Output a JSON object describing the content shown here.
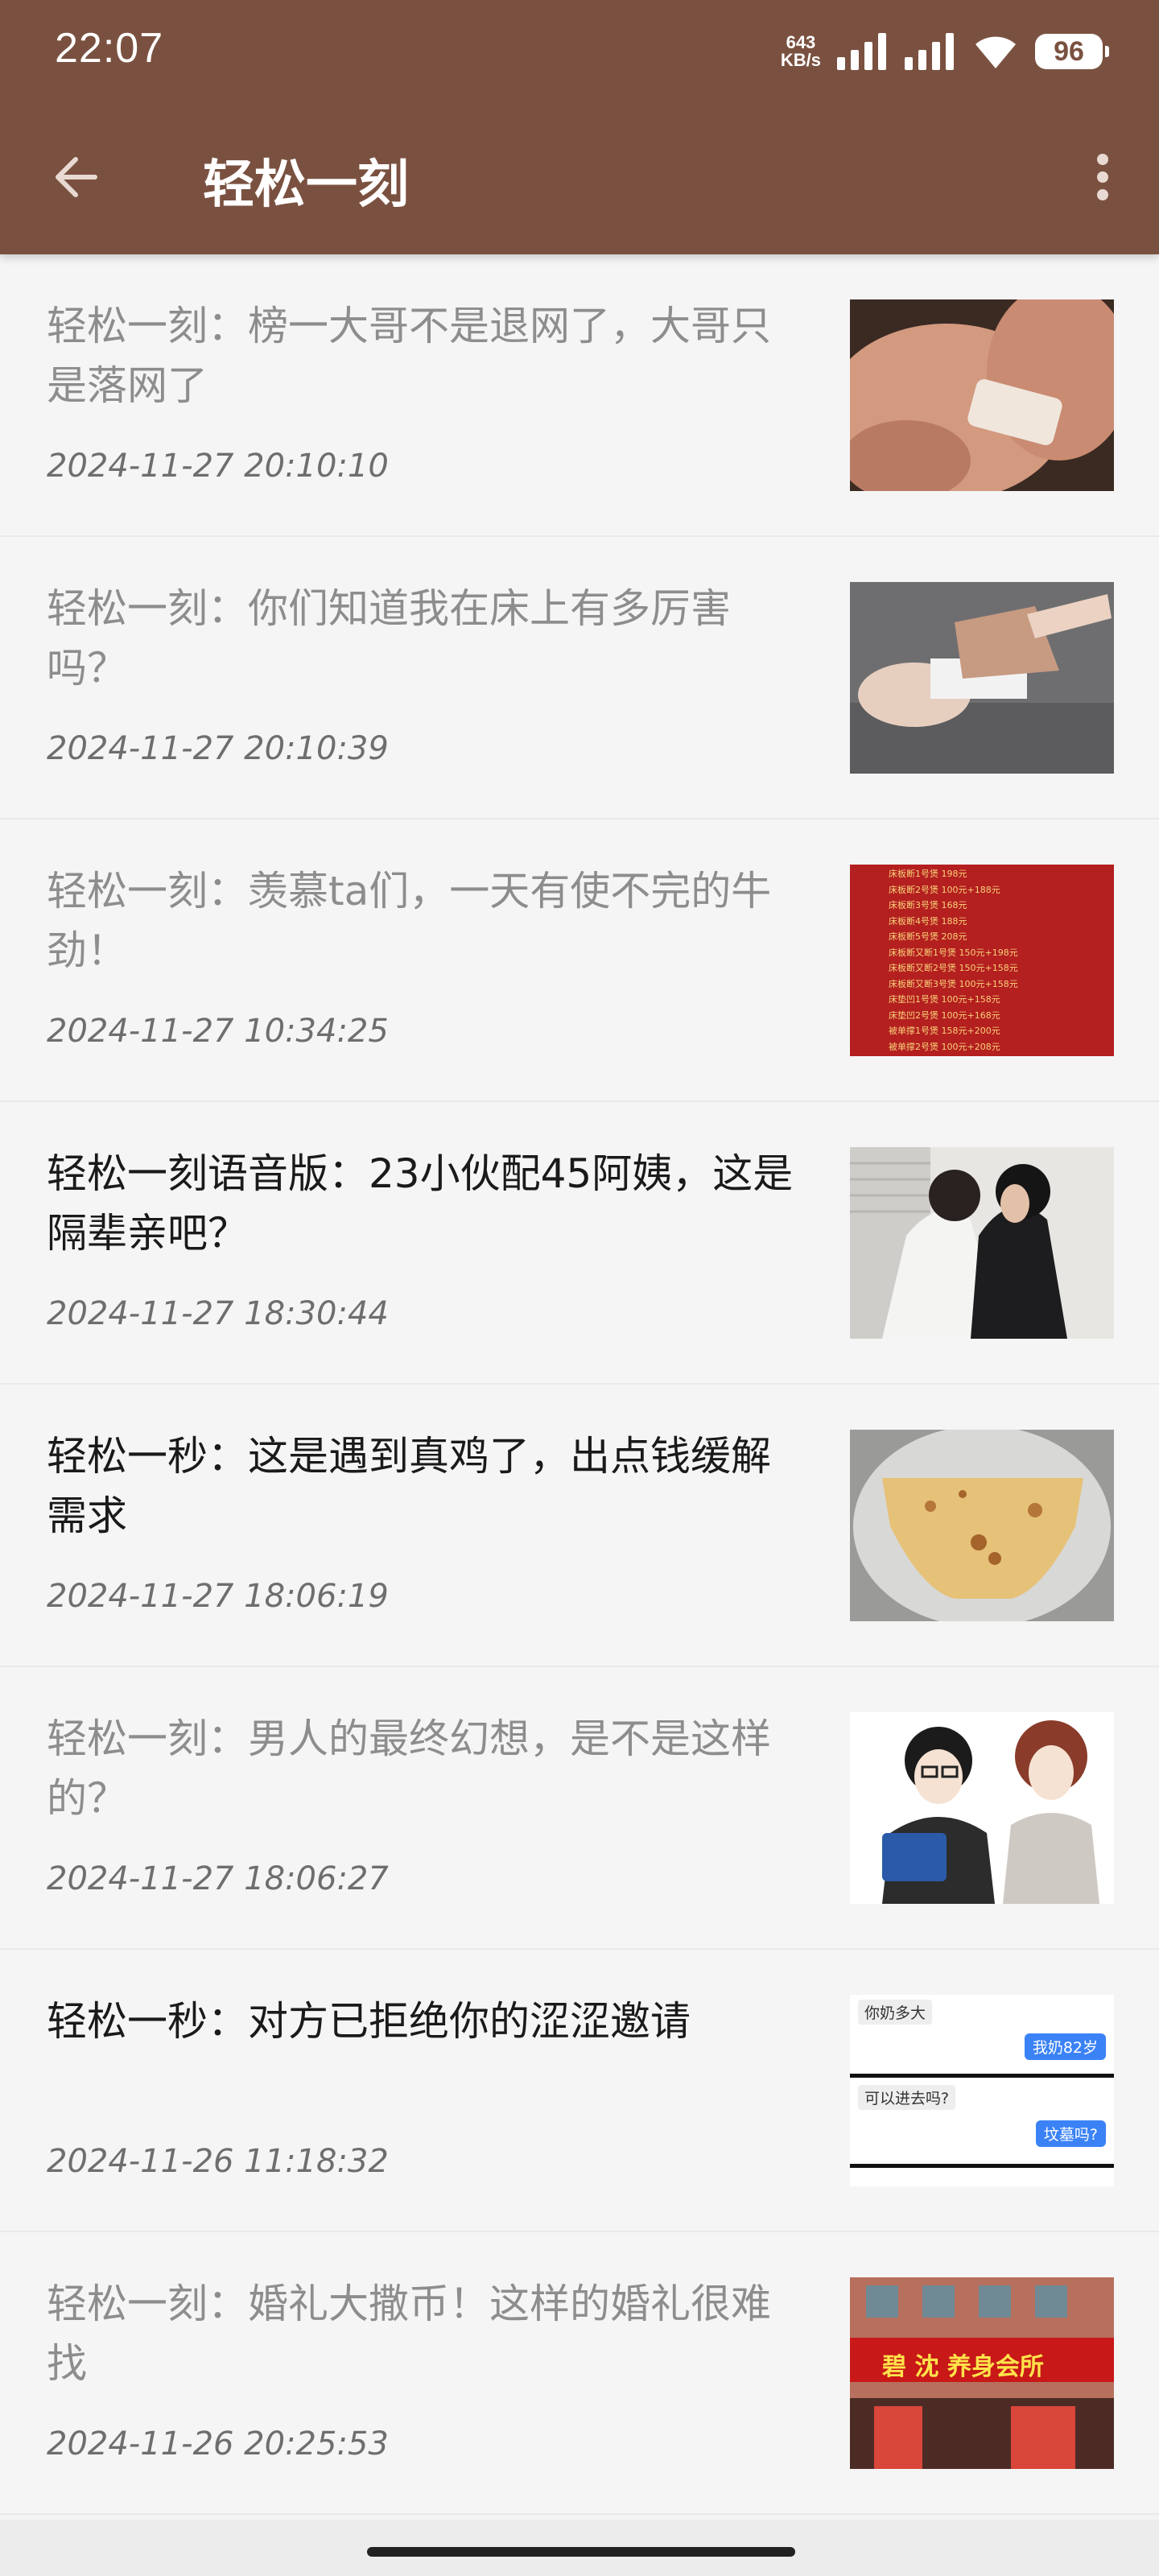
{
  "status_bar": {
    "time": "22:07",
    "net_speed_value": "643",
    "net_speed_unit": "KB/s",
    "battery": "96"
  },
  "header": {
    "title": "轻松一刻"
  },
  "colors": {
    "header_bg": "#7a5140",
    "read_title": "#8d8d8d",
    "unread_title": "#1a1a1a"
  },
  "articles": [
    {
      "title": "轻松一刻：榜一大哥不是退网了，大哥只是落网了",
      "date": "2024-11-27 20:10:10",
      "read": true
    },
    {
      "title": "轻松一刻：你们知道我在床上有多厉害吗？",
      "date": "2024-11-27 20:10:39",
      "read": true
    },
    {
      "title": "轻松一刻：羡慕ta们，一天有使不完的牛劲！",
      "date": "2024-11-27 10:34:25",
      "read": true
    },
    {
      "title": "轻松一刻语音版：23小伙配45阿姨，这是隔辈亲吧？",
      "date": "2024-11-27 18:30:44",
      "read": false
    },
    {
      "title": "轻松一秒：这是遇到真鸡了，出点钱缓解需求",
      "date": "2024-11-27 18:06:19",
      "read": false
    },
    {
      "title": "轻松一刻：男人的最终幻想，是不是这样的？",
      "date": "2024-11-27 18:06:27",
      "read": true
    },
    {
      "title": "轻松一秒：对方已拒绝你的涩涩邀请",
      "date": "2024-11-26 11:18:32",
      "read": false
    },
    {
      "title": "轻松一刻：婚礼大撒币！这样的婚礼很难找",
      "date": "2024-11-26 20:25:53",
      "read": true
    }
  ],
  "thumb_text": {
    "price_list": [
      "床板断1号煲 198元",
      "床板断2号煲 100元+188元",
      "床板断3号煲 168元",
      "床板断4号煲 188元",
      "床板断5号煲 208元",
      "床板断又断1号煲 150元+198元",
      "床板断又断2号煲 150元+158元",
      "床板断又断3号煲 100元+158元",
      "床垫凹1号煲 100元+158元",
      "床垫凹2号煲 100元+168元",
      "被单撑1号煲 158元+200元",
      "被单撑2号煲 100元+208元"
    ],
    "chat": {
      "msg1": "你奶多大",
      "reply1": "我奶82岁",
      "msg2": "可以进去吗?",
      "reply2": "坟墓吗?"
    },
    "shop_sign": "碧 沈 养身会所"
  },
  "icons": {
    "back": "arrow-left-icon",
    "menu": "more-vert-icon",
    "signal": "signal-icon",
    "wifi": "wifi-icon"
  }
}
